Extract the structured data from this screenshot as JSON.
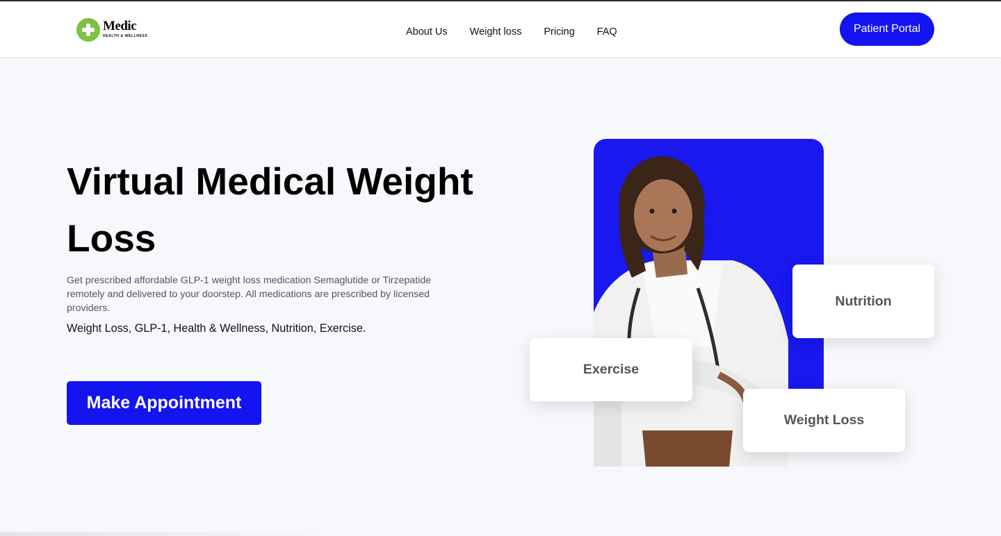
{
  "brand": {
    "name": "Medic",
    "tagline": "HEALTH & WELLNESS",
    "colors": {
      "primary": "#1414f0",
      "logo_green": "#7cc243"
    }
  },
  "nav": {
    "items": [
      {
        "label": "About Us"
      },
      {
        "label": "Weight loss"
      },
      {
        "label": "Pricing"
      },
      {
        "label": "FAQ"
      }
    ]
  },
  "header": {
    "portal_label": "Patient Portal"
  },
  "hero": {
    "title": "Virtual Medical Weight Loss",
    "description": "Get prescribed affordable GLP-1 weight loss medication Semaglutide or Tirzepatide remotely and delivered to your doorstep. All medications are prescribed by licensed providers.",
    "tags": "Weight Loss, GLP-1, Health & Wellness, Nutrition, Exercise.",
    "cta_label": "Make Appointment"
  },
  "feature_cards": {
    "nutrition": "Nutrition",
    "exercise": "Exercise",
    "weight_loss": "Weight Loss"
  }
}
